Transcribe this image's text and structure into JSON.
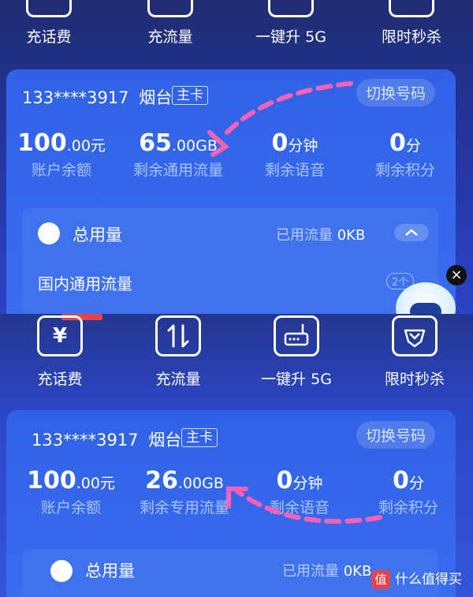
{
  "colors": {
    "card": "#3a6df0",
    "panel": "#2a44c4",
    "label": "#a9c3ff",
    "arrow": "#ff5fb4",
    "badge": "#e8434a"
  },
  "quick_actions": [
    {
      "label": "充话费",
      "icon": "yen-icon"
    },
    {
      "label": "充流量",
      "icon": "data-transfer-icon"
    },
    {
      "label": "一键升 5G",
      "icon": "router-5g-icon"
    },
    {
      "label": "限时秒杀",
      "icon": "flash-sale-icon"
    }
  ],
  "top": {
    "phone": "133****3917",
    "city": "烟台",
    "card_tag": "主卡",
    "switch_label": "切换号码",
    "balance": {
      "value": "100",
      "decimals": ".00元",
      "label": "账户余额"
    },
    "data": {
      "value": "65",
      "decimals": ".00GB",
      "label": "剩余通用流量"
    },
    "voice": {
      "value": "0",
      "unit": "分钟",
      "label": "剩余语音"
    },
    "points": {
      "value": "0",
      "unit": "分",
      "label": "剩余积分"
    },
    "usage_title": "总用量",
    "used_label": "已用流量",
    "used_value": "0KB",
    "domestic_label": "国内通用流量",
    "domestic_count": "2个"
  },
  "bottom": {
    "phone": "133****3917",
    "city": "烟台",
    "card_tag": "主卡",
    "switch_label": "切换号码",
    "balance": {
      "value": "100",
      "decimals": ".00元",
      "label": "账户余额"
    },
    "data": {
      "value": "26",
      "decimals": ".00GB",
      "label": "剩余专用流量"
    },
    "voice": {
      "value": "0",
      "unit": "分钟",
      "label": "剩余语音"
    },
    "points": {
      "value": "0",
      "unit": "分",
      "label": "剩余积分"
    },
    "usage_title": "总用量",
    "used_label": "已用流量",
    "used_value": "0KB"
  },
  "close_glyph": "×",
  "watermark": {
    "logo": "值",
    "text": "什么值得买"
  }
}
